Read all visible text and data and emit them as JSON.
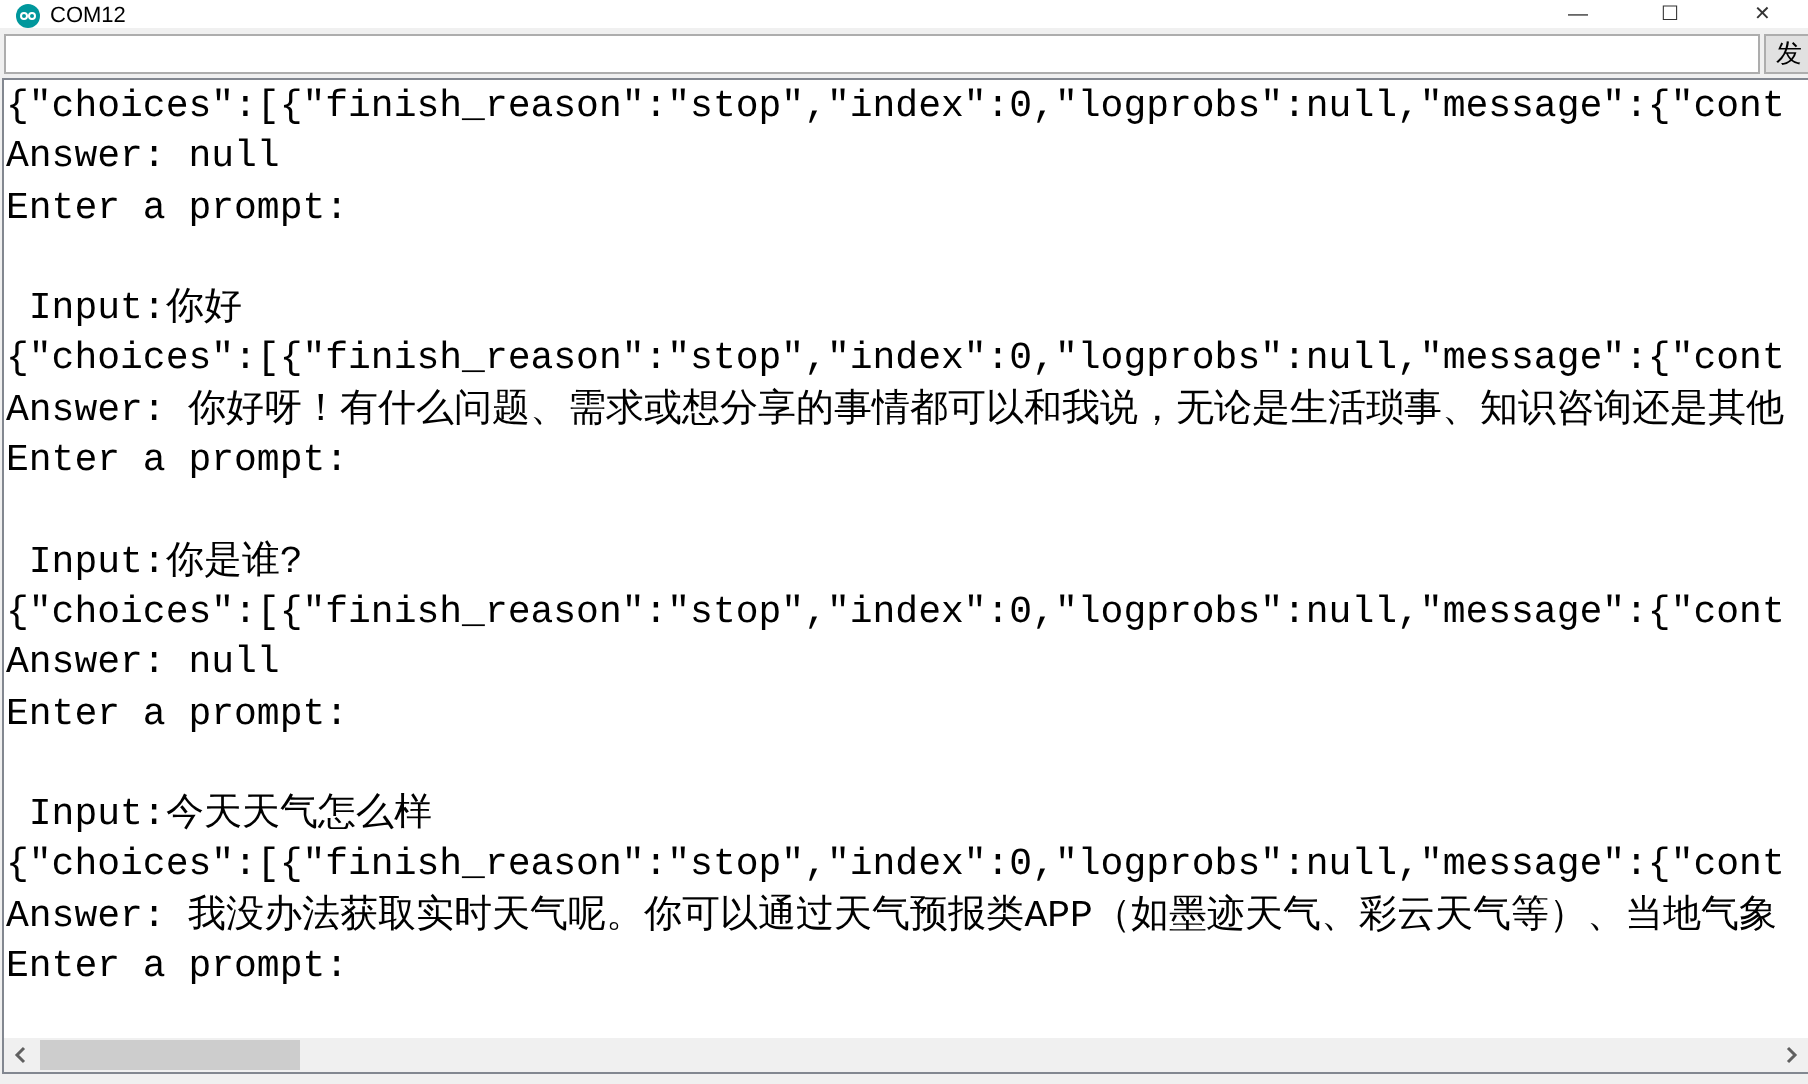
{
  "window": {
    "title": "COM12",
    "controls": [
      "—",
      "☐",
      "✕"
    ]
  },
  "input": {
    "send_label": "发"
  },
  "lines": [
    {
      "kind": "text",
      "text": "{\"choices\":[{\"finish_reason\":\"stop\",\"index\":0,\"logprobs\":null,\"message\":{\"cont"
    },
    {
      "kind": "text",
      "text": "Answer: null"
    },
    {
      "kind": "text",
      "text": "Enter a prompt:"
    },
    {
      "kind": "blank"
    },
    {
      "kind": "text",
      "text": " Input:你好"
    },
    {
      "kind": "text",
      "text": "{\"choices\":[{\"finish_reason\":\"stop\",\"index\":0,\"logprobs\":null,\"message\":{\"cont"
    },
    {
      "kind": "text",
      "text": "Answer: 你好呀！有什么问题、需求或想分享的事情都可以和我说，无论是生活琐事、知识咨询还是其他"
    },
    {
      "kind": "text",
      "text": "Enter a prompt:"
    },
    {
      "kind": "blank"
    },
    {
      "kind": "text",
      "text": " Input:你是谁?"
    },
    {
      "kind": "text",
      "text": "{\"choices\":[{\"finish_reason\":\"stop\",\"index\":0,\"logprobs\":null,\"message\":{\"cont"
    },
    {
      "kind": "text",
      "text": "Answer: null"
    },
    {
      "kind": "text",
      "text": "Enter a prompt:"
    },
    {
      "kind": "blank"
    },
    {
      "kind": "text",
      "text": " Input:今天天气怎么样"
    },
    {
      "kind": "text",
      "text": "{\"choices\":[{\"finish_reason\":\"stop\",\"index\":0,\"logprobs\":null,\"message\":{\"cont"
    },
    {
      "kind": "text",
      "text": "Answer: 我没办法获取实时天气呢。你可以通过天气预报类APP（如墨迹天气、彩云天气等）、当地气象"
    },
    {
      "kind": "text",
      "text": "Enter a prompt:"
    }
  ]
}
